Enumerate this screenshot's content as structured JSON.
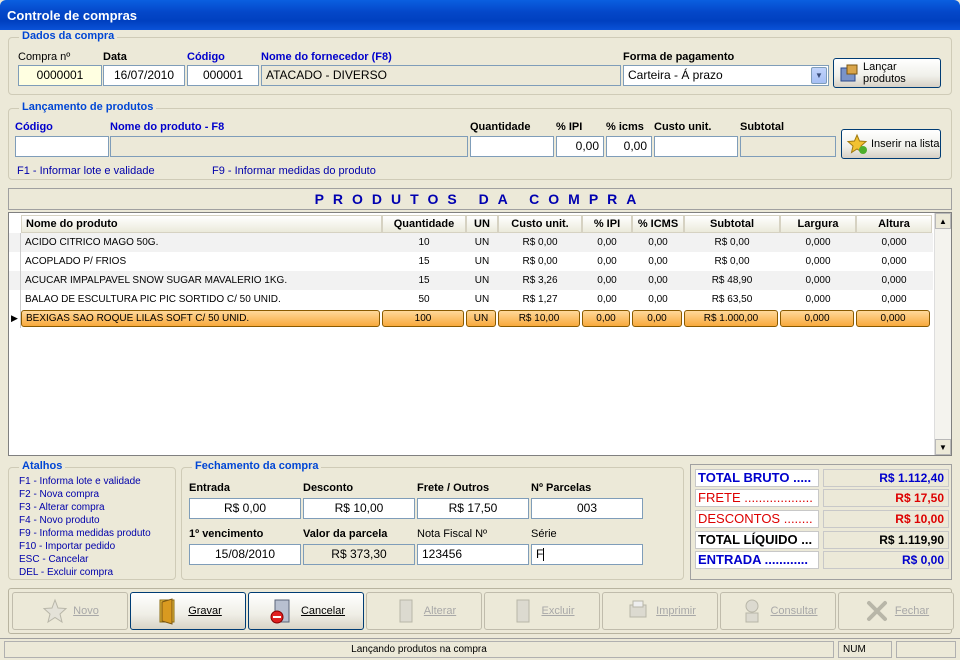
{
  "window": {
    "title": "Controle de compras"
  },
  "dados_compra": {
    "legend": "Dados da compra",
    "compra_label": "Compra nº",
    "compra_value": "0000001",
    "data_label": "Data",
    "data_value": "16/07/2010",
    "codigo_label": "Código",
    "codigo_value": "000001",
    "fornecedor_label": "Nome do fornecedor (F8)",
    "fornecedor_value": "ATACADO - DIVERSO",
    "pagamento_label": "Forma de pagamento",
    "pagamento_value": "Carteira - Á prazo",
    "lancar_button": "Lançar produtos"
  },
  "lancamento": {
    "legend": "Lançamento de produtos",
    "codigo_label": "Código",
    "nome_label": "Nome do produto - F8",
    "quantidade_label": "Quantidade",
    "ipi_label": "% IPI",
    "ipi_value": "0,00",
    "icms_label": "% icms",
    "icms_value": "0,00",
    "custo_label": "Custo unit.",
    "subtotal_label": "Subtotal",
    "inserir_button": "Inserir na lista",
    "hint_f1": "F1 - Informar lote e validade",
    "hint_f9": "F9 - Informar medidas do produto"
  },
  "banner": "PRODUTOS DA COMPRA",
  "grid": {
    "headers": [
      "Nome do produto",
      "Quantidade",
      "UN",
      "Custo unit.",
      "% IPI",
      "% ICMS",
      "Subtotal",
      "Largura",
      "Altura"
    ],
    "rows": [
      [
        "ACIDO CITRICO MAGO 50G.",
        "10",
        "UN",
        "R$ 0,00",
        "0,00",
        "0,00",
        "R$ 0,00",
        "0,000",
        "0,000"
      ],
      [
        "ACOPLADO P/ FRIOS",
        "15",
        "UN",
        "R$ 0,00",
        "0,00",
        "0,00",
        "R$ 0,00",
        "0,000",
        "0,000"
      ],
      [
        "ACUCAR IMPALPAVEL SNOW SUGAR MAVALERIO 1KG.",
        "15",
        "UN",
        "R$ 3,26",
        "0,00",
        "0,00",
        "R$ 48,90",
        "0,000",
        "0,000"
      ],
      [
        "BALAO DE ESCULTURA PIC PIC SORTIDO C/ 50 UNID.",
        "50",
        "UN",
        "R$ 1,27",
        "0,00",
        "0,00",
        "R$ 63,50",
        "0,000",
        "0,000"
      ],
      [
        "BEXIGAS SAO ROQUE LILAS SOFT C/ 50 UNID.",
        "100",
        "UN",
        "R$ 10,00",
        "0,00",
        "0,00",
        "R$ 1.000,00",
        "0,000",
        "0,000"
      ]
    ]
  },
  "atalhos": {
    "legend": "Atalhos",
    "items": [
      "F1 - Informa lote e validade",
      "F2 - Nova compra",
      "F3 - Alterar compra",
      "F4 - Novo produto",
      "F9 - Informa medidas produto",
      "F10 - Importar pedido",
      "ESC - Cancelar",
      "DEL - Excluir compra"
    ]
  },
  "fechamento": {
    "legend": "Fechamento da compra",
    "entrada_label": "Entrada",
    "entrada_value": "R$ 0,00",
    "desconto_label": "Desconto",
    "desconto_value": "R$ 10,00",
    "frete_label": "Frete / Outros",
    "frete_value": "R$ 17,50",
    "parcelas_label": "Nº Parcelas",
    "parcelas_value": "003",
    "vencimento_label": "1º vencimento",
    "vencimento_value": "15/08/2010",
    "parcela_label": "Valor da parcela",
    "parcela_value": "R$ 373,30",
    "nf_label": "Nota Fiscal Nº",
    "nf_value": "123456",
    "serie_label": "Série",
    "serie_value": "F"
  },
  "totals": [
    {
      "label": "TOTAL BRUTO .....",
      "value": "R$ 1.112,40",
      "color": "#0000cc"
    },
    {
      "label": "FRETE ...................",
      "value": "R$ 17,50",
      "color": "#dd0000"
    },
    {
      "label": "DESCONTOS ........",
      "value": "R$ 10,00",
      "color": "#dd0000"
    },
    {
      "label": "TOTAL LÍQUIDO ...",
      "value": "R$ 1.119,90",
      "color": "#000000"
    },
    {
      "label": "ENTRADA ............",
      "value": "R$ 0,00",
      "color": "#0000cc"
    }
  ],
  "toolbar": {
    "novo": "Novo",
    "gravar": "Gravar",
    "cancelar": "Cancelar",
    "alterar": "Alterar",
    "excluir": "Excluir",
    "imprimir": "Imprimir",
    "consultar": "Consultar",
    "fechar": "Fechar"
  },
  "status": {
    "message": "Lançando produtos na compra",
    "num": "NUM"
  }
}
